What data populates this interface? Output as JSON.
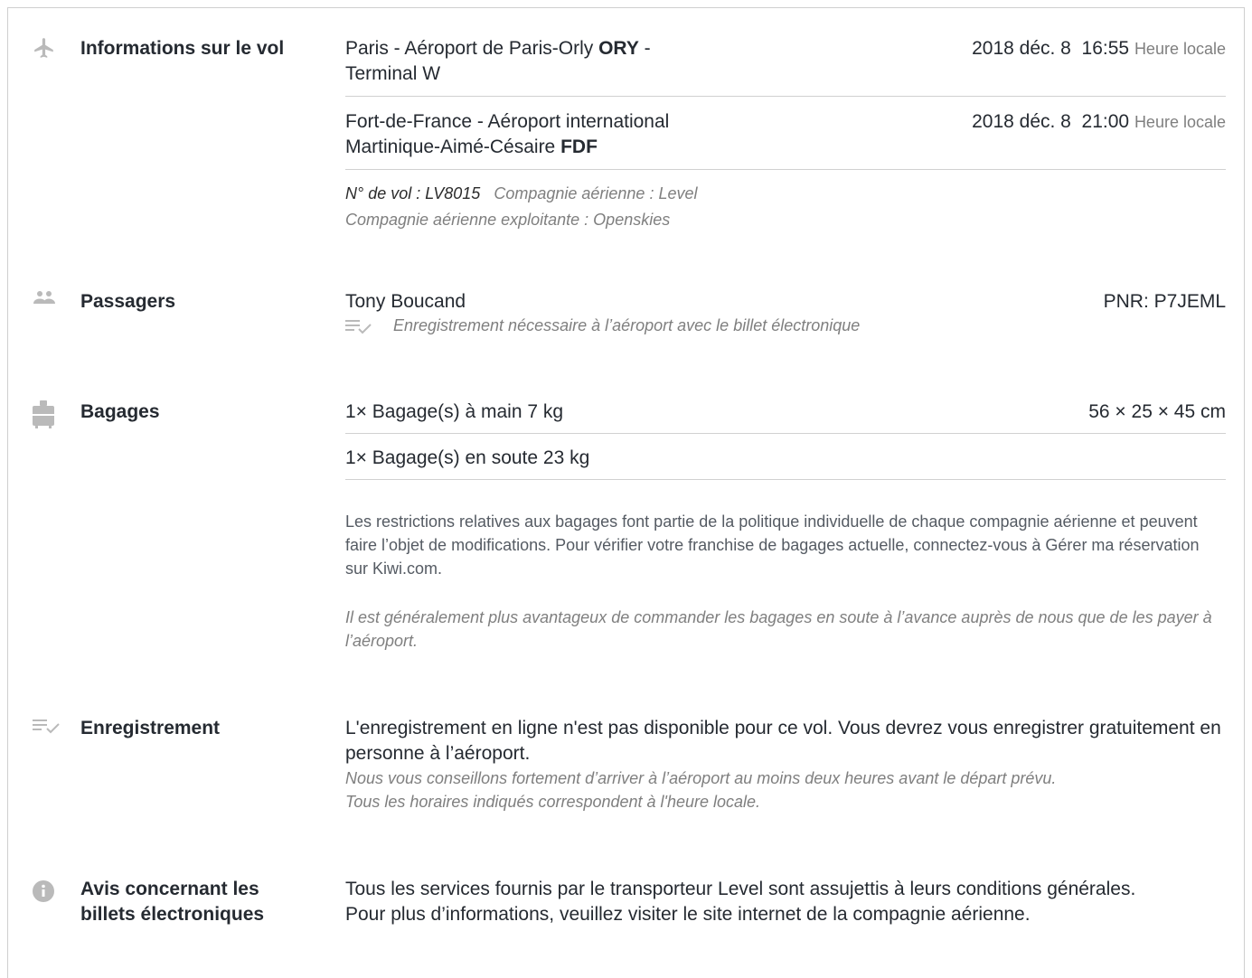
{
  "flight": {
    "label": "Informations sur le vol",
    "departure": {
      "place": "Paris - Aéroport de Paris-Orly ",
      "code": "ORY",
      "terminal": " - Terminal W",
      "date": "2018 déc. 8",
      "time": "16:55",
      "local_label": "Heure locale"
    },
    "arrival": {
      "place": "Fort-de-France - Aéroport international Martinique-Aimé-Césaire ",
      "code": "FDF",
      "date": "2018 déc. 8",
      "time": "21:00",
      "local_label": "Heure locale"
    },
    "flight_number": "N° de vol : LV8015",
    "airline": "Compagnie aérienne : Level",
    "operating_airline": "Compagnie aérienne exploitante : Openskies"
  },
  "passengers": {
    "label": "Passagers",
    "name": "Tony Boucand",
    "pnr": "PNR: P7JEML",
    "checkin_note": "Enregistrement nécessaire à l’aéroport avec le billet électronique"
  },
  "baggage": {
    "label": "Bagages",
    "items": [
      {
        "text": "1× Bagage(s) à main 7 kg",
        "dims": "56 × 25 × 45 cm"
      },
      {
        "text": "1× Bagage(s) en soute 23 kg",
        "dims": ""
      }
    ],
    "policy": "Les restrictions relatives aux bagages font partie de la politique individuelle de chaque compagnie aérienne et peuvent faire l’objet de modifications. Pour vérifier votre franchise de bagages actuelle, connectez-vous à Gérer ma réservation sur Kiwi.com.",
    "tip": "Il est généralement plus avantageux de commander les bagages en soute à l’avance auprès de nous que de les payer à l’aéroport."
  },
  "checkin": {
    "label": "Enregistrement",
    "text": "L'enregistrement en ligne n'est pas disponible pour ce vol. Vous devrez vous enregistrer gratuitement en personne à l’aéroport.",
    "note1": "Nous vous conseillons fortement d’arriver à l’aéroport au moins deux heures avant le départ prévu.",
    "note2": "Tous les horaires indiqués correspondent à l'heure locale."
  },
  "eticket": {
    "label": "Avis concernant les billets électroniques",
    "text": "Tous les services fournis par le transporteur Level sont assujettis à leurs conditions générales. Pour plus d’informations, veuillez visiter le site internet de la compagnie aérienne."
  },
  "icons": {
    "flight": "airplane-icon",
    "passengers": "passengers-icon",
    "baggage": "suitcase-icon",
    "checkin": "checklist-icon",
    "eticket": "info-icon",
    "color": "#bababa"
  }
}
